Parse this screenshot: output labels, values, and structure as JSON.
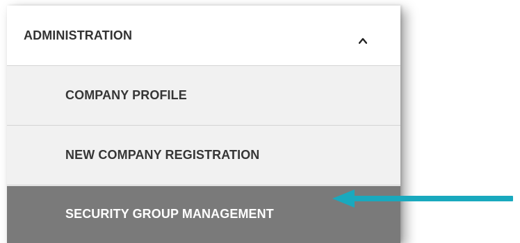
{
  "menu": {
    "header_label": "ADMINISTRATION",
    "header_icon": "chevron-up-icon",
    "items": [
      {
        "label": "COMPANY PROFILE"
      },
      {
        "label": "NEW COMPANY REGISTRATION"
      },
      {
        "label": "SECURITY GROUP MANAGEMENT",
        "active": true
      }
    ]
  },
  "colors": {
    "active_background": "#7a7a7a",
    "item_background": "#f1f1f1",
    "arrow": "#19a9be"
  },
  "annotation": {
    "icon": "arrow-left-icon"
  }
}
